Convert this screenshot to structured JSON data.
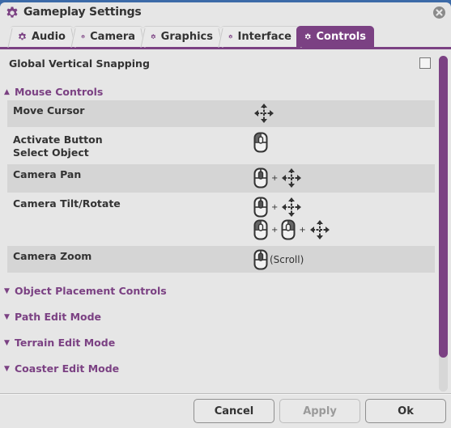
{
  "window": {
    "title": "Gameplay Settings",
    "icon": "gear-icon",
    "close_icon": "close-icon"
  },
  "tabs": [
    {
      "label": "Audio",
      "icon": "gear-icon",
      "active": false
    },
    {
      "label": "Camera",
      "icon": "gear-icon",
      "active": false
    },
    {
      "label": "Graphics",
      "icon": "gear-icon",
      "active": false
    },
    {
      "label": "Interface",
      "icon": "gear-icon",
      "active": false
    },
    {
      "label": "Controls",
      "icon": "gear-icon",
      "active": true
    }
  ],
  "settings": {
    "global_vertical_snapping": {
      "label": "Global Vertical Snapping",
      "checked": false
    }
  },
  "sections": [
    {
      "title": "Mouse Controls",
      "expanded": true,
      "rows": [
        {
          "label": "Move Cursor",
          "bindings": [
            [
              "move-icon"
            ]
          ]
        },
        {
          "label": "Activate Button\nSelect Object",
          "bindings": [
            [
              "mouse-left-icon"
            ]
          ]
        },
        {
          "label": "Camera Pan",
          "bindings": [
            [
              "mouse-middle-icon",
              "+",
              "move-icon"
            ]
          ]
        },
        {
          "label": "Camera Tilt/Rotate",
          "bindings": [
            [
              "mouse-middle-icon",
              "+",
              "move-icon"
            ],
            [
              "mouse-left-icon",
              "+",
              "mouse-right-icon",
              "+",
              "move-icon"
            ]
          ]
        },
        {
          "label": "Camera Zoom",
          "bindings": [
            [
              "mouse-middle-icon",
              "(Scroll)"
            ]
          ]
        }
      ]
    },
    {
      "title": "Object Placement Controls",
      "expanded": false
    },
    {
      "title": "Path Edit Mode",
      "expanded": false
    },
    {
      "title": "Terrain Edit Mode",
      "expanded": false
    },
    {
      "title": "Coaster Edit Mode",
      "expanded": false
    }
  ],
  "labels": {
    "activate_line1": "Activate Button",
    "activate_line2": "Select Object",
    "plus": "+",
    "scroll": "(Scroll)",
    "expanded_marker": "▲",
    "collapsed_marker": "▼"
  },
  "buttons": {
    "cancel": "Cancel",
    "apply": "Apply",
    "ok": "Ok"
  },
  "colors": {
    "accent": "#7b4183",
    "background": "#e6e6e6",
    "row_shade": "#d5d5d5",
    "text": "#333333"
  }
}
